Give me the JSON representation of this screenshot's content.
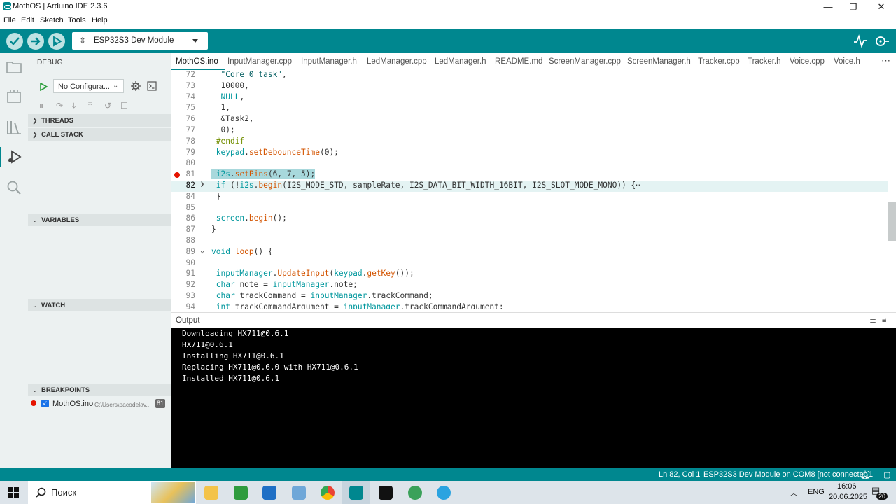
{
  "window": {
    "title": "MothOS | Arduino IDE 2.3.6",
    "minimize": "—",
    "maximize": "❐",
    "close": "✕"
  },
  "menu": [
    "File",
    "Edit",
    "Sketch",
    "Tools",
    "Help"
  ],
  "toolbar": {
    "board": "ESP32S3 Dev Module"
  },
  "debug": {
    "header": "DEBUG",
    "config": "No Configura...",
    "sections": {
      "threads": "THREADS",
      "callstack": "CALL STACK",
      "variables": "VARIABLES",
      "watch": "WATCH",
      "breakpoints": "BREAKPOINTS"
    },
    "breakpoint": {
      "file": "MothOS.ino",
      "path": "C:\\Users\\pacodelav...",
      "line": "81"
    }
  },
  "tabs": [
    "MothOS.ino",
    "InputManager.cpp",
    "InputManager.h",
    "LedManager.cpp",
    "LedManager.h",
    "README.md",
    "ScreenManager.cpp",
    "ScreenManager.h",
    "Tracker.cpp",
    "Tracker.h",
    "Voice.cpp",
    "Voice.h"
  ],
  "editor": {
    "lines": [
      {
        "n": "72",
        "t": "  \"Core 0 task\","
      },
      {
        "n": "73",
        "t": "  10000,"
      },
      {
        "n": "74",
        "t": "  NULL,"
      },
      {
        "n": "75",
        "t": "  1,"
      },
      {
        "n": "76",
        "t": "  &Task2,"
      },
      {
        "n": "77",
        "t": "  0);"
      },
      {
        "n": "78",
        "t": " #endif"
      },
      {
        "n": "79",
        "t": " keypad.setDebounceTime(0);"
      },
      {
        "n": "80",
        "t": ""
      },
      {
        "n": "81",
        "t": " i2s.setPins(6, 7, 5);"
      },
      {
        "n": "82",
        "t": " if (!i2s.begin(I2S_MODE_STD, sampleRate, I2S_DATA_BIT_WIDTH_16BIT, I2S_SLOT_MODE_MONO)) {⋯"
      },
      {
        "n": "84",
        "t": " }"
      },
      {
        "n": "85",
        "t": ""
      },
      {
        "n": "86",
        "t": " screen.begin();"
      },
      {
        "n": "87",
        "t": "}"
      },
      {
        "n": "88",
        "t": ""
      },
      {
        "n": "89",
        "t": "void loop() {"
      },
      {
        "n": "90",
        "t": ""
      },
      {
        "n": "91",
        "t": " inputManager.UpdateInput(keypad.getKey());"
      },
      {
        "n": "92",
        "t": " char note = inputManager.note;"
      },
      {
        "n": "93",
        "t": " char trackCommand = inputManager.trackCommand;"
      },
      {
        "n": "94",
        "t": " int trackCommandArgument = inputManager.trackCommandArgument;"
      }
    ]
  },
  "output": {
    "title": "Output",
    "lines": [
      "Downloading HX711@0.6.1",
      "HX711@0.6.1",
      "Installing HX711@0.6.1",
      "Replacing HX711@0.6.0 with HX711@0.6.1",
      "Installed HX711@0.6.1"
    ]
  },
  "status": {
    "position": "Ln 82, Col 1",
    "board": "ESP32S3 Dev Module on COM8 [not connected]",
    "notifications": "1"
  },
  "taskbar": {
    "search": "Поиск",
    "lang": "ENG",
    "time": "16:06",
    "date": "20.06.2025",
    "badge": "20"
  },
  "colors": {
    "accent": "#00878f",
    "breakpoint": "#e51400",
    "highlight": "#a8d8dc"
  }
}
